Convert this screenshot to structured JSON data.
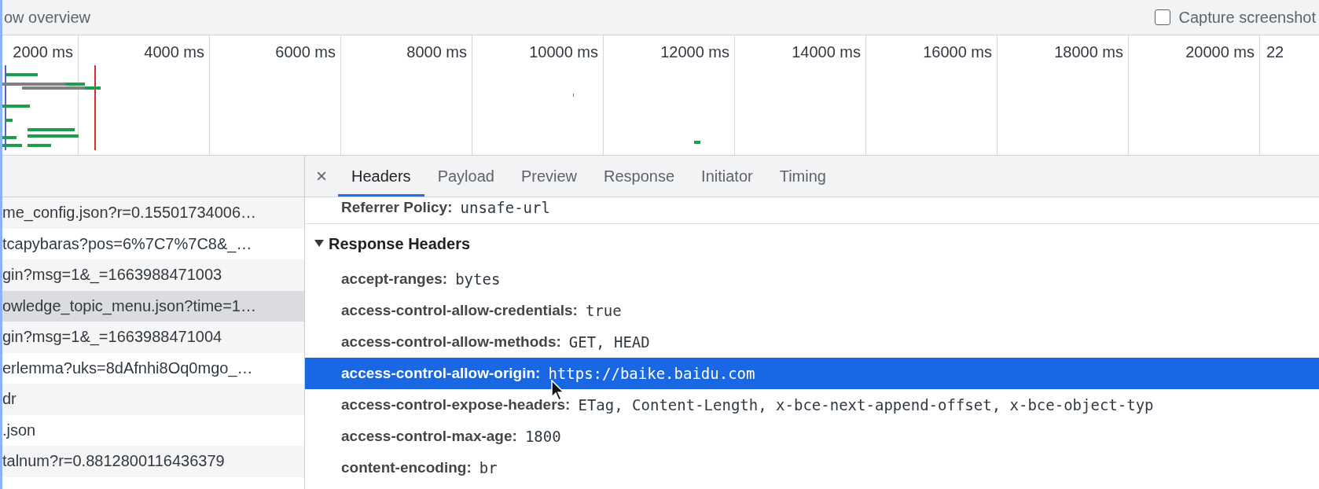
{
  "toolbar": {
    "overview_label": "ow overview",
    "capture_screenshots": {
      "label": "Capture screenshot",
      "checked": false
    }
  },
  "timeline": {
    "ticks": [
      "2000 ms",
      "4000 ms",
      "6000 ms",
      "8000 ms",
      "10000 ms",
      "12000 ms",
      "14000 ms",
      "16000 ms",
      "18000 ms",
      "20000 ms",
      "22"
    ]
  },
  "requests": [
    {
      "name": "me_config.json?r=0.15501734006…",
      "selected": false
    },
    {
      "name": "tcapybaras?pos=6%7C7%7C8&_…",
      "selected": false
    },
    {
      "name": "gin?msg=1&_=1663988471003",
      "selected": false
    },
    {
      "name": "owledge_topic_menu.json?time=1…",
      "selected": true
    },
    {
      "name": "gin?msg=1&_=1663988471004",
      "selected": false
    },
    {
      "name": "erlemma?uks=8dAfnhi8Oq0mgo_…",
      "selected": false
    },
    {
      "name": "dr",
      "selected": false
    },
    {
      "name": ".json",
      "selected": false
    },
    {
      "name": "talnum?r=0.8812800116436379",
      "selected": false
    }
  ],
  "details": {
    "close": "×",
    "tabs": [
      {
        "label": "Headers",
        "selected": true
      },
      {
        "label": "Payload",
        "selected": false
      },
      {
        "label": "Preview",
        "selected": false
      },
      {
        "label": "Response",
        "selected": false
      },
      {
        "label": "Initiator",
        "selected": false
      },
      {
        "label": "Timing",
        "selected": false
      }
    ],
    "general_tail": {
      "name": "Referrer Policy:",
      "value": "unsafe-url"
    },
    "section": {
      "title": "Response Headers",
      "expanded": true,
      "headers": [
        {
          "name": "accept-ranges:",
          "value": "bytes",
          "selected": false
        },
        {
          "name": "access-control-allow-credentials:",
          "value": "true",
          "selected": false
        },
        {
          "name": "access-control-allow-methods:",
          "value": "GET, HEAD",
          "selected": false
        },
        {
          "name": "access-control-allow-origin:",
          "value": "https://baike.baidu.com",
          "selected": true
        },
        {
          "name": "access-control-expose-headers:",
          "value": "ETag, Content-Length, x-bce-next-append-offset, x-bce-object-typ",
          "selected": false
        },
        {
          "name": "access-control-max-age:",
          "value": "1800",
          "selected": false
        },
        {
          "name": "content-encoding:",
          "value": "br",
          "selected": false
        }
      ]
    }
  }
}
